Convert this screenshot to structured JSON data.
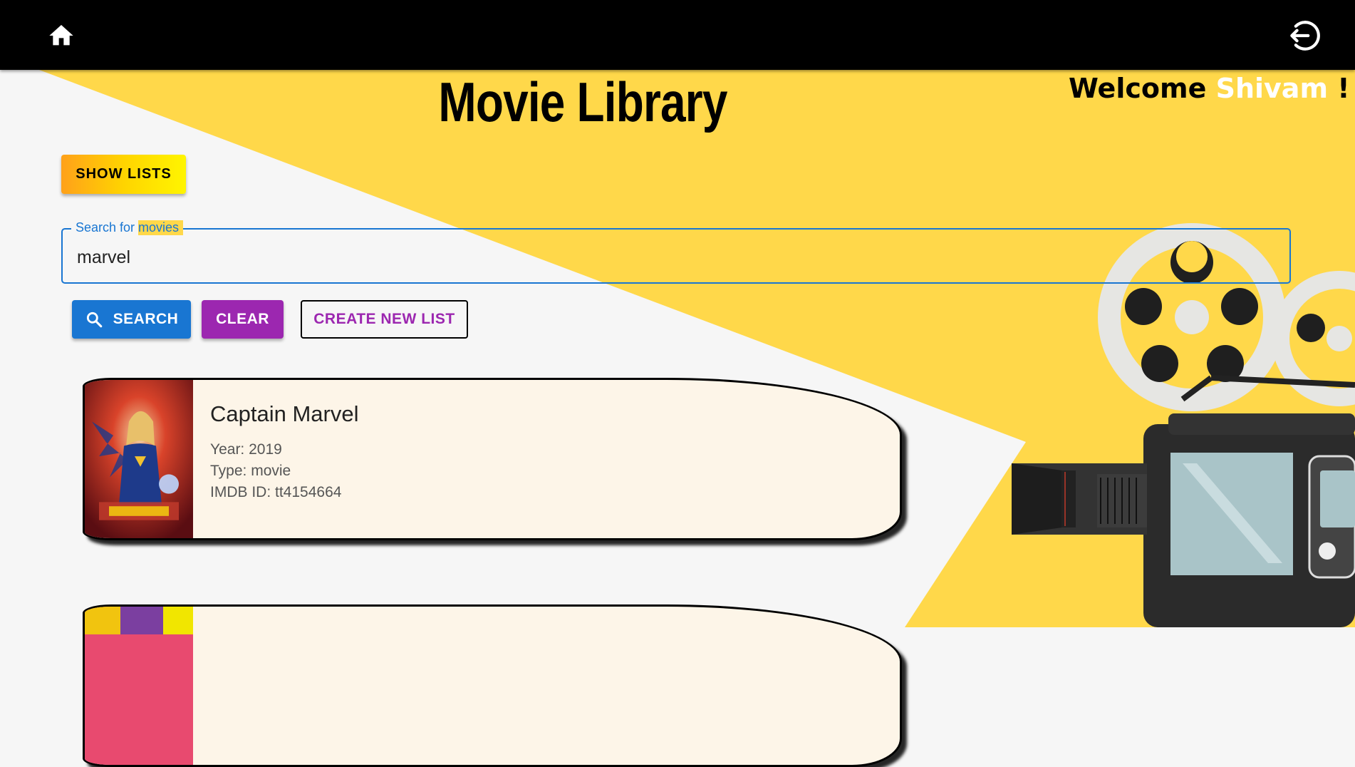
{
  "header": {
    "home_icon": "home-icon",
    "logout_icon": "logout-icon"
  },
  "page": {
    "title": "Movie Library",
    "welcome_prefix": "Welcome",
    "user_name": "Shivam",
    "welcome_suffix": "!"
  },
  "buttons": {
    "show_lists": "SHOW LISTS",
    "search": "SEARCH",
    "clear": "CLEAR",
    "create_new_list": "CREATE NEW LIST"
  },
  "search": {
    "label": "Search for movies",
    "value": "marvel"
  },
  "movies": [
    {
      "title": "Captain Marvel",
      "year_text": "Year: 2019",
      "type_text": "Type: movie",
      "imdb_text": "IMDB ID: tt4154664"
    }
  ],
  "colors": {
    "primary": "#1976d2",
    "secondary": "#9c27b0",
    "background_yellow": "#ffd84a",
    "card_background": "#fdf5e8"
  }
}
